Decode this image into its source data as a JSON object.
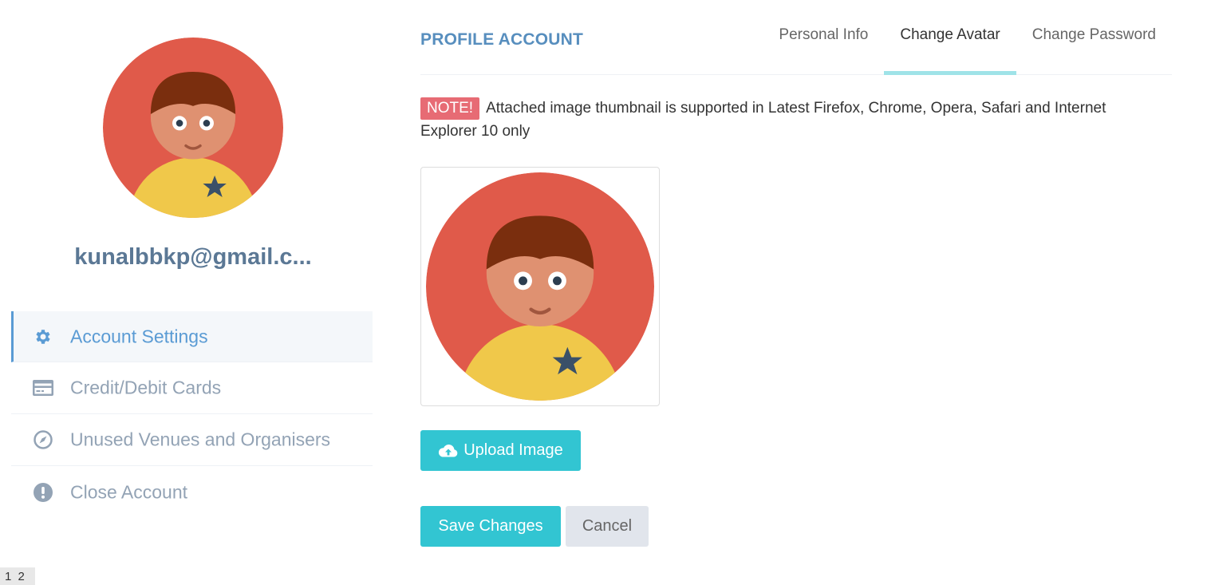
{
  "sidebar": {
    "avatar_icon": "child-avatar",
    "username": "kunalbbkp@gmail.c...",
    "items": [
      {
        "label": "Account Settings",
        "icon": "gear-icon",
        "active": true
      },
      {
        "label": "Credit/Debit Cards",
        "icon": "credit-card-icon",
        "active": false
      },
      {
        "label": "Unused Venues and Organisers",
        "icon": "compass-icon",
        "active": false
      },
      {
        "label": "Close Account",
        "icon": "exclamation-circle-icon",
        "active": false
      }
    ]
  },
  "main": {
    "title": "PROFILE ACCOUNT",
    "tabs": [
      {
        "label": "Personal Info",
        "active": false
      },
      {
        "label": "Change Avatar",
        "active": true
      },
      {
        "label": "Change Password",
        "active": false
      }
    ],
    "note": {
      "badge": "NOTE!",
      "text": "Attached image thumbnail is supported in Latest Firefox, Chrome, Opera, Safari and Internet Explorer 10 only"
    },
    "upload_label": "Upload Image",
    "save_label": "Save Changes",
    "cancel_label": "Cancel"
  },
  "pager": {
    "text": "1 2"
  },
  "colors": {
    "accent": "#32c5d2",
    "title": "#578ebe",
    "active_menu": "#5a9bd4",
    "note_badge": "#e76b74",
    "avatar_bg": "#e05a4a"
  }
}
